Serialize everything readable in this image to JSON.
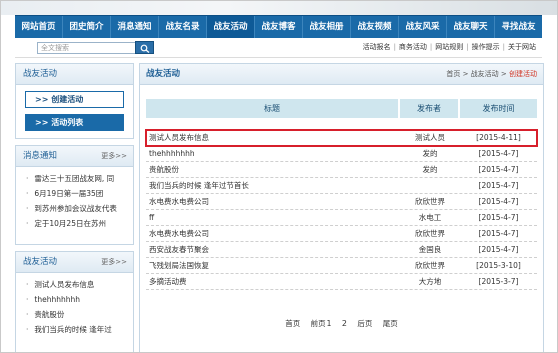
{
  "nav": [
    {
      "label": "网站首页",
      "active": false
    },
    {
      "label": "团史简介",
      "active": false
    },
    {
      "label": "消息通知",
      "active": false
    },
    {
      "label": "战友名录",
      "active": false
    },
    {
      "label": "战友活动",
      "active": true
    },
    {
      "label": "战友博客",
      "active": false
    },
    {
      "label": "战友相册",
      "active": false
    },
    {
      "label": "战友视频",
      "active": false
    },
    {
      "label": "战友风采",
      "active": false
    },
    {
      "label": "战友聊天",
      "active": false
    },
    {
      "label": "寻找战友",
      "active": false
    }
  ],
  "search": {
    "placeholder": "全文搜索"
  },
  "toplinks": [
    "活动报名",
    "商务活动",
    "网站规则",
    "操作提示",
    "关于网站"
  ],
  "left": {
    "activity": {
      "title": "战友活动",
      "buttons": [
        ">>  创建活动",
        ">>  活动列表"
      ]
    },
    "notices": {
      "title": "消息通知",
      "more": "更多>>",
      "items": [
        "雷达三十五团战友网, 同",
        "6月19日第一届35团",
        "到苏州参加会议战友代表",
        "定于10月25日在苏州"
      ]
    },
    "activity2": {
      "title": "战友活动",
      "more": "更多>>",
      "items": [
        "测试人员发布信息",
        "thehhhhhhh",
        "贵航股份",
        "我们当兵的时候 逢年过"
      ]
    }
  },
  "main": {
    "title": "战友活动",
    "breadcrumb": {
      "home": "首页",
      "sep1": " > ",
      "section": "战友活动",
      "sep2": " > ",
      "current": "创建活动"
    },
    "columns": [
      "标题",
      "发布者",
      "发布时间"
    ],
    "rows": [
      {
        "title": "测试人员发布信息",
        "publisher": "测试人员",
        "date": "[2015-4-11]",
        "highlight": true
      },
      {
        "title": "thehhhhhhh",
        "publisher": "发的",
        "date": "[2015-4-7]"
      },
      {
        "title": "贵航股份",
        "publisher": "发的",
        "date": "[2015-4-7]"
      },
      {
        "title": "我们当兵的时候 逢年过节首长",
        "publisher": "",
        "date": "[2015-4-7]"
      },
      {
        "title": "水电费水电费公司",
        "publisher": "欣欣世界",
        "date": "[2015-4-7]"
      },
      {
        "title": "ff",
        "publisher": "水电工",
        "date": "[2015-4-7]"
      },
      {
        "title": "水电费水电费公司",
        "publisher": "欣欣世界",
        "date": "[2015-4-7]"
      },
      {
        "title": "西安战友春节聚会",
        "publisher": "金国良",
        "date": "[2015-4-7]"
      },
      {
        "title": "飞残划局法国恢复",
        "publisher": "欣欣世界",
        "date": "[2015-3-10]"
      },
      {
        "title": "多摘活动费",
        "publisher": "大方地",
        "date": "[2015-3-7]"
      }
    ],
    "pager": {
      "first": "首页",
      "prev": "前页",
      "page1": "1",
      "page2": "2",
      "next": "后页",
      "last": "尾页"
    }
  }
}
